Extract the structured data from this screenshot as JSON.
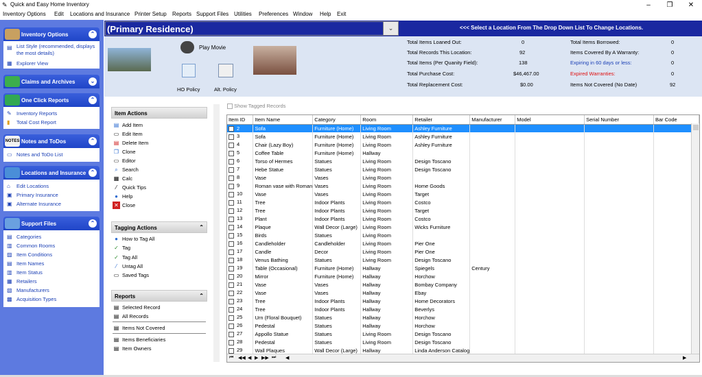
{
  "window": {
    "title": "Quick and Easy Home Inventory",
    "controls": {
      "min": "–",
      "max": "❐",
      "close": "✕"
    }
  },
  "menu": [
    "Inventory Options",
    "Edit",
    "Locations and Insurance",
    "Printer Setup",
    "Reports",
    "Support Files",
    "Utilities",
    "Preferences",
    "Window",
    "Help",
    "Exit"
  ],
  "sidebar": {
    "inventory": {
      "title": "Inventory Options",
      "items": [
        "List Style (recommended, displays",
        "the most details)",
        "Explorer View"
      ]
    },
    "claims": {
      "title": "Claims and Archives"
    },
    "reports": {
      "title": "One Click Reports",
      "items": [
        "Inventory Reports",
        "Total Cost Report"
      ]
    },
    "notes": {
      "title": "Notes and ToDos",
      "items": [
        "Notes and ToDo List"
      ]
    },
    "locations": {
      "title": "Locations and Insurance",
      "items": [
        "Edit Locations",
        "Primary Insurance",
        "Alternate Insurance"
      ]
    },
    "support": {
      "title": "Support Files",
      "items": [
        "Categories",
        "Common Rooms",
        "Item Conditions",
        "Item Names",
        "Item Status",
        "Retailers",
        "Manufacturers",
        "Acquisition Types"
      ]
    }
  },
  "location": {
    "name": "(Primary Residence)",
    "hint": "<<< Select a Location From The Drop Down List To Change Locations."
  },
  "media": {
    "play_movie": "Play Movie",
    "ho_policy": "HO Policy",
    "alt_policy": "Alt. Policy"
  },
  "stats": {
    "left": [
      [
        "Total Items Loaned Out:",
        "0"
      ],
      [
        "Total Records This Location:",
        "92"
      ],
      [
        "Total Items (Per Quanity Field):",
        "138"
      ],
      [
        "Total Purchase Cost:",
        "$46,467.00"
      ],
      [
        "Total Replacement Cost:",
        "$0.00"
      ]
    ],
    "right": [
      [
        "Total Items Borrowed:",
        "0"
      ],
      [
        "Items Covered By A Warranty:",
        "0"
      ],
      [
        "Expiring in 60 days or less:",
        "0"
      ],
      [
        "Expired Warranties:",
        "0"
      ],
      [
        "Items Not Covered (No Date)",
        "92"
      ]
    ],
    "colors": {
      "expiring": "#1a3fb5",
      "expired": "#e01010"
    }
  },
  "item_actions": {
    "title": "Item Actions",
    "items": [
      "Add Item",
      "Edit Item",
      "Delete Item",
      "Clone",
      "Editor",
      "Search",
      "Calc",
      "Quick Tips",
      "Help",
      "Close"
    ]
  },
  "tagging": {
    "title": "Tagging Actions",
    "items": [
      "How to Tag All",
      "Tag",
      "Tag All",
      "Untag All",
      "Saved Tags"
    ]
  },
  "reports": {
    "title": "Reports",
    "items": [
      "Selected Record",
      "All Records",
      "Items Not Covered",
      "Items Beneficiaries",
      "Item Owners"
    ]
  },
  "show_tagged": "Show Tagged Records",
  "grid": {
    "columns": [
      "Item ID",
      "Item Name",
      "Category",
      "Room",
      "Retailer",
      "Manufacturer",
      "Model",
      "Serial Number",
      "Bar Code"
    ],
    "rows": [
      [
        "2",
        "Sofa",
        "Furniture (Home)",
        "Living Room",
        "Ashley Furniture",
        "",
        "",
        "",
        ""
      ],
      [
        "3",
        "Sofa",
        "Furniture (Home)",
        "Living Room",
        "Ashley Furniture",
        "",
        "",
        "",
        ""
      ],
      [
        "4",
        "Chair (Lazy Boy)",
        "Furniture (Home)",
        "Living Room",
        "Ashley Furniture",
        "",
        "",
        "",
        ""
      ],
      [
        "5",
        "Coffee Table",
        "Furniture (Home)",
        "Hallway",
        "",
        "",
        "",
        "",
        ""
      ],
      [
        "6",
        "Torso of Hermes",
        "Statues",
        "Living Room",
        "Design Toscano",
        "",
        "",
        "",
        ""
      ],
      [
        "7",
        "Hebe Statue",
        "Statues",
        "Living Room",
        "Design Toscano",
        "",
        "",
        "",
        ""
      ],
      [
        "8",
        "Vase",
        "Vases",
        "Living Room",
        "",
        "",
        "",
        "",
        ""
      ],
      [
        "9",
        "Roman vase with Roman",
        "Vases",
        "Living Room",
        "Home Goods",
        "",
        "",
        "",
        ""
      ],
      [
        "10",
        "Vase",
        "Vases",
        "Living Room",
        "Target",
        "",
        "",
        "",
        ""
      ],
      [
        "11",
        "Tree",
        "Indoor Plants",
        "Living Room",
        "Costco",
        "",
        "",
        "",
        ""
      ],
      [
        "12",
        "Tree",
        "Indoor Plants",
        "Living Room",
        "Target",
        "",
        "",
        "",
        ""
      ],
      [
        "13",
        "Plant",
        "Indoor Plants",
        "Living Room",
        "Costco",
        "",
        "",
        "",
        ""
      ],
      [
        "14",
        "Plaque",
        "Wall Decor (Large)",
        "Living Room",
        "Wicks Furniture",
        "",
        "",
        "",
        ""
      ],
      [
        "15",
        "Birds",
        "Statues",
        "Living Room",
        "",
        "",
        "",
        "",
        ""
      ],
      [
        "16",
        "Candleholder",
        "Candleholder",
        "Living Room",
        "Pier One",
        "",
        "",
        "",
        ""
      ],
      [
        "17",
        "Candle",
        "Decor",
        "Living Room",
        "Pier One",
        "",
        "",
        "",
        ""
      ],
      [
        "18",
        "Venus Bathing",
        "Statues",
        "Living Room",
        "Design Toscano",
        "",
        "",
        "",
        ""
      ],
      [
        "19",
        "Table (Occasional)",
        "Furniture (Home)",
        "Hallway",
        "Spiegels",
        "Century",
        "",
        "",
        ""
      ],
      [
        "20",
        "Mirror",
        "Furniture (Home)",
        "Hallway",
        "Horchow",
        "",
        "",
        "",
        ""
      ],
      [
        "21",
        "Vase",
        "Vases",
        "Hallway",
        "Bombay Company",
        "",
        "",
        "",
        ""
      ],
      [
        "22",
        "Vase",
        "Vases",
        "Hallway",
        "Ebay",
        "",
        "",
        "",
        ""
      ],
      [
        "23",
        "Tree",
        "Indoor Plants",
        "Hallway",
        "Home Decorators",
        "",
        "",
        "",
        ""
      ],
      [
        "24",
        "Tree",
        "Indoor Plants",
        "Hallway",
        "Beverlys",
        "",
        "",
        "",
        ""
      ],
      [
        "25",
        "Urn (Floral Bouquet)",
        "Statues",
        "Hallway",
        "Horchow",
        "",
        "",
        "",
        ""
      ],
      [
        "26",
        "Pedestal",
        "Statues",
        "Hallway",
        "Horchow",
        "",
        "",
        "",
        ""
      ],
      [
        "27",
        "Appollo Statue",
        "Statues",
        "Living Room",
        "Design Toscano",
        "",
        "",
        "",
        ""
      ],
      [
        "28",
        "Pedestal",
        "Statues",
        "Living Room",
        "Design Toscano",
        "",
        "",
        "",
        ""
      ],
      [
        "29",
        "Wall Plaques",
        "Wall Decor (Large)",
        "Hallway",
        "Linda Anderson Catalog",
        "",
        "",
        "",
        ""
      ]
    ]
  }
}
